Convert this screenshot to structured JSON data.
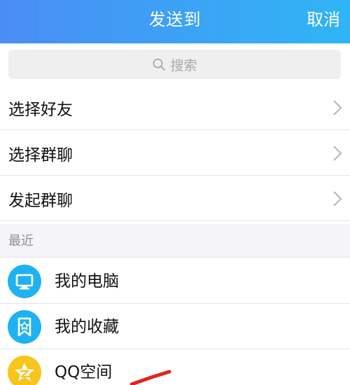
{
  "header": {
    "title": "发送到",
    "cancel_label": "取消",
    "gradient": [
      "#4a8df5",
      "#2fb5f5"
    ]
  },
  "search": {
    "placeholder": "搜索",
    "icon": "search-icon"
  },
  "menu": [
    {
      "label": "选择好友",
      "icon": "chevron-right-icon"
    },
    {
      "label": "选择群聊",
      "icon": "chevron-right-icon"
    },
    {
      "label": "发起群聊",
      "icon": "chevron-right-icon"
    }
  ],
  "recent": {
    "section_label": "最近",
    "items": [
      {
        "label": "我的电脑",
        "icon": "computer-icon",
        "color": "#1fb2f0"
      },
      {
        "label": "我的收藏",
        "icon": "bookmark-star-icon",
        "color": "#1fb2f0"
      },
      {
        "label": "QQ空间",
        "icon": "qzone-star-icon",
        "color": "#f7c51b"
      }
    ]
  }
}
